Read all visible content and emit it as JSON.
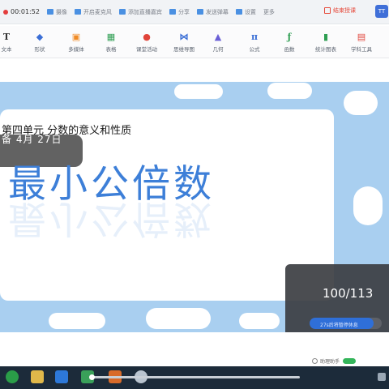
{
  "status_bar": {
    "timer": "00:01:52",
    "items": [
      "摄像",
      "开启麦克风",
      "添加直播嘉宾",
      "分享",
      "发送弹幕",
      "设置"
    ],
    "more": "更多",
    "end_button": "结束授课",
    "avatar": "TT"
  },
  "toolbar": {
    "tools": [
      {
        "label": "文本",
        "icon": "text-icon",
        "glyph": "T",
        "color": "#333333"
      },
      {
        "label": "形状",
        "icon": "shape-icon",
        "glyph": "◆",
        "color": "#3b6fd6"
      },
      {
        "label": "多媒体",
        "icon": "media-icon",
        "glyph": "▣",
        "color": "#f08a24"
      },
      {
        "label": "表格",
        "icon": "table-icon",
        "glyph": "▦",
        "color": "#2e9e52"
      },
      {
        "label": "课堂活动",
        "icon": "activity-icon",
        "glyph": "●",
        "color": "#e0443a"
      },
      {
        "label": "思维导图",
        "icon": "mindmap-icon",
        "glyph": "⋈",
        "color": "#3b6fd6"
      },
      {
        "label": "几何",
        "icon": "geometry-icon",
        "glyph": "▲",
        "color": "#6a5fd6"
      },
      {
        "label": "公式",
        "icon": "formula-icon",
        "glyph": "π",
        "color": "#3b6fd6"
      },
      {
        "label": "函数",
        "icon": "function-icon",
        "glyph": "ƒ",
        "color": "#2e9e52"
      },
      {
        "label": "统计图表",
        "icon": "chart-icon",
        "glyph": "▮",
        "color": "#2e9e52"
      },
      {
        "label": "学科工具",
        "icon": "subject-tools-icon",
        "glyph": "▤",
        "color": "#e0443a"
      }
    ]
  },
  "slide": {
    "subtitle": "第四单元  分数的意义和性质",
    "date": "备  4月 27日",
    "title": "最小公倍数"
  },
  "page_panel": {
    "counter": "100/113",
    "progress_fraction": 0.885,
    "status": "27s后将暂停休息"
  },
  "assistant": {
    "label": "助理助手"
  }
}
